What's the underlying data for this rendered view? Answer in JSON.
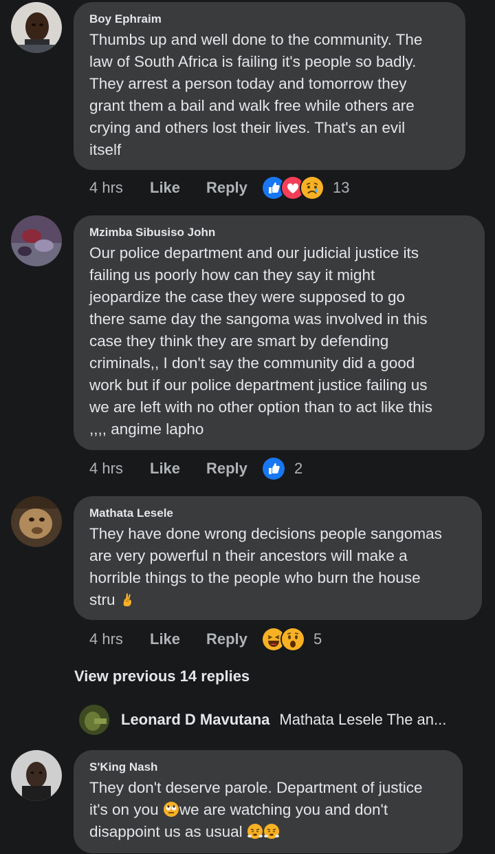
{
  "comments": [
    {
      "author": "Boy Ephraim",
      "text": "Thumbs up and well done to the community. The\nlaw of South Africa is failing it's people so badly.\nThey arrest a person today and tomorrow they\ngrant  them a bail and walk free while others are\ncrying and others lost their lives. That's an evil\nitself",
      "time": "4 hrs",
      "like": "Like",
      "reply": "Reply",
      "reaction_icons": [
        "like-reaction",
        "love-reaction",
        "sad-reaction"
      ],
      "reaction_count": "13"
    },
    {
      "author": "Mzimba Sibusiso John",
      "text": "Our police department and our judicial justice its\nfailing us poorly how can they say it might\njeopardize the case they were supposed to go\nthere same day the sangoma was involved in this\ncase they think they are smart by defending\ncriminals,, I don't say the community did a  good\nwork but if our  police  department justice failing us\nwe are left with no other option than to  act like this\n ,,,, angime lapho",
      "time": "4 hrs",
      "like": "Like",
      "reply": "Reply",
      "reaction_icons": [
        "like-reaction"
      ],
      "reaction_count": "2"
    },
    {
      "author": "Mathata Lesele",
      "text_main": "They have done wrong decisions people sangomas\nare very powerful n their ancestors will make a\nhorrible things to the people who burn the house\nstru ",
      "text_emoji": "crossed-fingers-emoji",
      "time": "4 hrs",
      "like": "Like",
      "reply": "Reply",
      "reaction_icons": [
        "haha-reaction",
        "wow-reaction"
      ],
      "reaction_count": "5"
    }
  ],
  "view_previous": "View previous 14 replies",
  "collapsed_reply": {
    "author": "Leonard D Mavutana",
    "text": "Mathata Lesele The an..."
  },
  "last_comment": {
    "author": "S'King Nash",
    "text_line1": "They don't deserve parole. Department of justice",
    "text_line2a": "it's on you ",
    "text_line2b": "we are watching you and don't",
    "text_line3": "disappoint us as usual ",
    "emojis": [
      "eye-roll-emoji",
      "steam-face-emoji",
      "steam-face-emoji"
    ]
  },
  "colors": {
    "background": "#18191a",
    "bubble": "#3a3b3c",
    "text": "#e4e6eb",
    "secondary": "#b0b3b8",
    "like_blue": "#1877f2",
    "love_red": "#f33e58",
    "emoji_yellow": "#f7b125"
  }
}
